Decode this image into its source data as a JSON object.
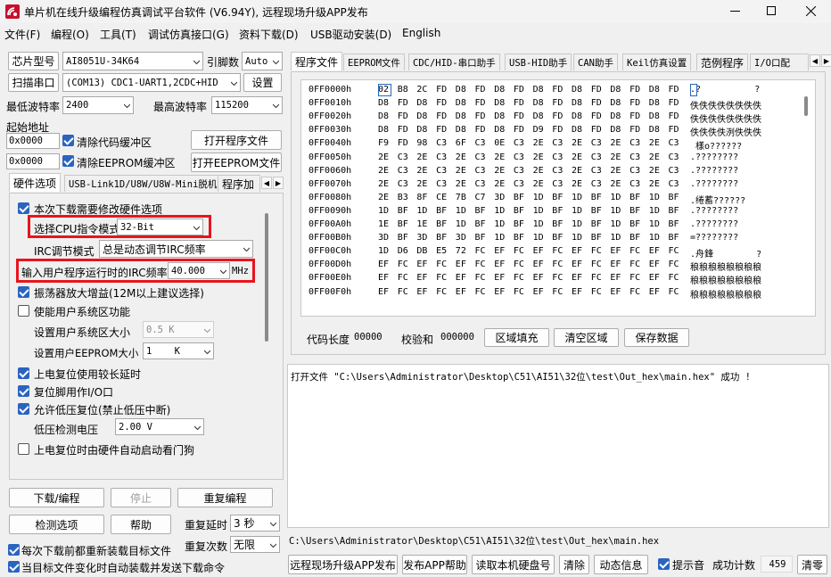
{
  "window": {
    "title": "单片机在线升级编程仿真调试平台软件 (V6.94Y), 远程现场升级APP发布"
  },
  "menu": [
    "文件(F)",
    "编程(O)",
    "工具(T)",
    "调试仿真接口(G)",
    "资料下载(D)",
    "USB驱动安装(D)",
    "English"
  ],
  "left": {
    "chip_label": "芯片型号",
    "chip_value": "AI8051U-34K64",
    "pins_label": "引脚数",
    "pins_value": "Auto",
    "scan_button": "扫描串口",
    "port_value": "(COM13) CDC1-UART1,2CDC+HID",
    "settings_button": "设置",
    "min_baud_label": "最低波特率",
    "min_baud_value": "2400",
    "max_baud_label": "最高波特率",
    "max_baud_value": "115200",
    "start_addr_label": "起始地址",
    "addr1": "0x0000",
    "clear_code_label": "清除代码缓冲区",
    "open_prog_button": "打开程序文件",
    "addr2": "0x0000",
    "clear_eeprom_label": "清除EEPROM缓冲区",
    "open_eeprom_button": "打开EEPROM文件",
    "tabs": [
      "硬件选项",
      "USB-Link1D/U8W/U8W-Mini脱机",
      "程序加"
    ],
    "options": {
      "need_modify": "本次下载需要修改硬件选项",
      "cpu_mode_label": "选择CPU指令模式",
      "cpu_mode_value": "32-Bit",
      "irc_label": "IRC调节模式",
      "irc_value": "总是动态调节IRC频率",
      "freq_label": "输入用户程序运行时的IRC频率",
      "freq_value": "40.000",
      "freq_unit": "MHz",
      "osc_gain": "振荡器放大增益(12M以上建议选择)",
      "user_sys_area": "使能用户系统区功能",
      "sys_size_label": "设置用户系统区大小",
      "sys_size_value": "0.5 K",
      "eeprom_size_label": "设置用户EEPROM大小",
      "eeprom_size_value": "1    K",
      "power_reset_delay": "上电复位使用较长延时",
      "reset_pin_io": "复位脚用作I/O口",
      "low_voltage_reset": "允许低压复位(禁止低压中断)",
      "lv_detect_label": "低压检测电压",
      "lv_detect_value": "2.00 V",
      "watchdog": "上电复位时由硬件自动启动看门狗"
    },
    "download_button": "下载/编程",
    "stop_button": "停止",
    "reprogram_button": "重复编程",
    "detect_button": "检测选项",
    "help_button": "帮助",
    "repeat_delay_label": "重复延时",
    "repeat_delay_value": "3 秒",
    "repeat_count_label": "重复次数",
    "repeat_count_value": "无限",
    "reload_before": "每次下载前都重新装载目标文件",
    "auto_send": "当目标文件变化时自动装载并发送下载命令"
  },
  "right": {
    "tabs": [
      "程序文件",
      "EEPROM文件",
      "CDC/HID-串口助手",
      "USB-HID助手",
      "CAN助手",
      "Keil仿真设置",
      "范例程序",
      "I/O口配"
    ],
    "hex_rows": [
      {
        "addr": "0FF0000h",
        "bytes": [
          "02",
          "B8",
          "2C",
          "FD",
          "D8",
          "FD",
          "D8",
          "FD",
          "D8",
          "FD",
          "D8",
          "FD",
          "D8",
          "FD",
          "D8",
          "FD"
        ],
        "ascii": ".?          ?"
      },
      {
        "addr": "0FF0010h",
        "bytes": [
          "D8",
          "FD",
          "D8",
          "FD",
          "D8",
          "FD",
          "D8",
          "FD",
          "D8",
          "FD",
          "D8",
          "FD",
          "D8",
          "FD",
          "D8",
          "FD"
        ],
        "ascii": "佚佚佚佚佚佚佚佚"
      },
      {
        "addr": "0FF0020h",
        "bytes": [
          "D8",
          "FD",
          "D8",
          "FD",
          "D8",
          "FD",
          "D8",
          "FD",
          "D8",
          "FD",
          "D8",
          "FD",
          "D8",
          "FD",
          "D8",
          "FD"
        ],
        "ascii": "佚佚佚佚佚佚佚佚"
      },
      {
        "addr": "0FF0030h",
        "bytes": [
          "D8",
          "FD",
          "D8",
          "FD",
          "D8",
          "FD",
          "D8",
          "FD",
          "D9",
          "FD",
          "D8",
          "FD",
          "D8",
          "FD",
          "D8",
          "FD"
        ],
        "ascii": "佚佚佚佚洌佚佚佚"
      },
      {
        "addr": "0FF0040h",
        "bytes": [
          "F9",
          "FD",
          "98",
          "C3",
          "6F",
          "C3",
          "0E",
          "C3",
          "2E",
          "C3",
          "2E",
          "C3",
          "2E",
          "C3",
          "2E",
          "C3"
        ],
        "ascii": " 樣o??????"
      },
      {
        "addr": "0FF0050h",
        "bytes": [
          "2E",
          "C3",
          "2E",
          "C3",
          "2E",
          "C3",
          "2E",
          "C3",
          "2E",
          "C3",
          "2E",
          "C3",
          "2E",
          "C3",
          "2E",
          "C3"
        ],
        "ascii": ".????????"
      },
      {
        "addr": "0FF0060h",
        "bytes": [
          "2E",
          "C3",
          "2E",
          "C3",
          "2E",
          "C3",
          "2E",
          "C3",
          "2E",
          "C3",
          "2E",
          "C3",
          "2E",
          "C3",
          "2E",
          "C3"
        ],
        "ascii": ".????????"
      },
      {
        "addr": "0FF0070h",
        "bytes": [
          "2E",
          "C3",
          "2E",
          "C3",
          "2E",
          "C3",
          "2E",
          "C3",
          "2E",
          "C3",
          "2E",
          "C3",
          "2E",
          "C3",
          "2E",
          "C3"
        ],
        "ascii": ".????????"
      },
      {
        "addr": "0FF0080h",
        "bytes": [
          "2E",
          "B3",
          "8F",
          "CE",
          "7B",
          "C7",
          "3D",
          "BF",
          "1D",
          "BF",
          "1D",
          "BF",
          "1D",
          "BF",
          "1D",
          "BF"
        ],
        "ascii": ".绻蓄??????"
      },
      {
        "addr": "0FF0090h",
        "bytes": [
          "1D",
          "BF",
          "1D",
          "BF",
          "1D",
          "BF",
          "1D",
          "BF",
          "1D",
          "BF",
          "1D",
          "BF",
          "1D",
          "BF",
          "1D",
          "BF"
        ],
        "ascii": ".????????"
      },
      {
        "addr": "0FF00A0h",
        "bytes": [
          "1E",
          "BF",
          "1E",
          "BF",
          "1D",
          "BF",
          "1D",
          "BF",
          "1D",
          "BF",
          "1D",
          "BF",
          "1D",
          "BF",
          "1D",
          "BF"
        ],
        "ascii": ".????????"
      },
      {
        "addr": "0FF00B0h",
        "bytes": [
          "3D",
          "BF",
          "3D",
          "BF",
          "3D",
          "BF",
          "1D",
          "BF",
          "1D",
          "BF",
          "1D",
          "BF",
          "1D",
          "BF",
          "1D",
          "BF"
        ],
        "ascii": "=????????"
      },
      {
        "addr": "0FF00C0h",
        "bytes": [
          "1D",
          "D6",
          "DB",
          "E5",
          "72",
          "FC",
          "EF",
          "FC",
          "EF",
          "FC",
          "EF",
          "FC",
          "EF",
          "FC",
          "EF",
          "FC"
        ],
        "ascii": ".舟鋒        ?"
      },
      {
        "addr": "0FF00D0h",
        "bytes": [
          "EF",
          "FC",
          "EF",
          "FC",
          "EF",
          "FC",
          "EF",
          "FC",
          "EF",
          "FC",
          "EF",
          "FC",
          "EF",
          "FC",
          "EF",
          "FC"
        ],
        "ascii": "稂稂稂稂稂稂稂稂"
      },
      {
        "addr": "0FF00E0h",
        "bytes": [
          "EF",
          "FC",
          "EF",
          "FC",
          "EF",
          "FC",
          "EF",
          "FC",
          "EF",
          "FC",
          "EF",
          "FC",
          "EF",
          "FC",
          "EF",
          "FC"
        ],
        "ascii": "稂稂稂稂稂稂稂稂"
      },
      {
        "addr": "0FF00F0h",
        "bytes": [
          "EF",
          "FC",
          "EF",
          "FC",
          "EF",
          "FC",
          "EF",
          "FC",
          "EF",
          "FC",
          "EF",
          "FC",
          "EF",
          "FC",
          "EF",
          "FC"
        ],
        "ascii": "稂稂稂稂稂稂稂稂"
      }
    ],
    "code_len_label": "代码长度",
    "code_len_value": "00000",
    "checksum_label": "校验和",
    "checksum_value": "000000",
    "fill_button": "区域填充",
    "clear_area_button": "清空区域",
    "save_button": "保存数据",
    "log_text": "打开文件 \"C:\\Users\\Administrator\\Desktop\\C51\\AI51\\32位\\test\\Out_hex\\main.hex\" 成功 !",
    "path_text": "C:\\Users\\Administrator\\Desktop\\C51\\AI51\\32位\\test\\Out_hex\\main.hex",
    "remote_button": "远程现场升级APP发布",
    "publish_help_button": "发布APP帮助",
    "read_disk_button": "读取本机硬盘号",
    "clear_button": "清除",
    "dynamic_info_button": "动态信息",
    "beep_label": "提示音",
    "success_label": "成功计数",
    "success_value": "459",
    "reset_count_button": "清零"
  },
  "colors": {
    "highlight": "#e8141c",
    "check": "#2a64c0"
  }
}
